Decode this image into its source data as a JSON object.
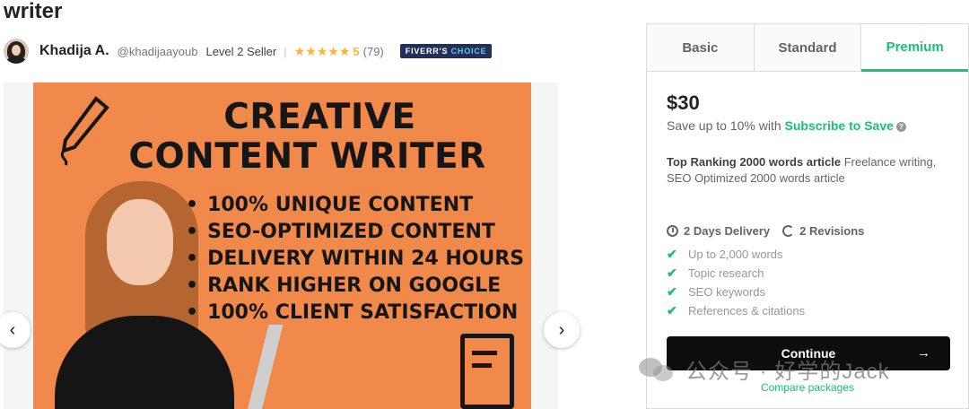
{
  "gig": {
    "title": "writer"
  },
  "seller": {
    "name": "Khadija A.",
    "handle": "@khadijaayoub",
    "level": "Level 2 Seller",
    "separator": "|",
    "stars": "★★★★★",
    "rating": "5",
    "reviews": "(79)",
    "badge_main": "FIVERR'S",
    "badge_accent": "CHOICE"
  },
  "gallery": {
    "headline_1": "CREATIVE",
    "headline_2": "CONTENT WRITER",
    "bullets": [
      "100% UNIQUE CONTENT",
      "SEO-OPTIMIZED CONTENT",
      "DELIVERY WITHIN 24 HOURS",
      "RANK HIGHER ON GOOGLE",
      "100% CLIENT SATISFACTION"
    ],
    "prev_icon": "‹",
    "next_icon": "›"
  },
  "package": {
    "tabs": [
      "Basic",
      "Standard",
      "Premium"
    ],
    "active_tab": "Premium",
    "price": "$30",
    "save_prefix": "Save up to 10% with ",
    "save_link": "Subscribe to Save",
    "desc_bold": "Top Ranking 2000 words article",
    "desc_rest": " Freelance writing, SEO Optimized 2000 words article",
    "delivery": "2 Days Delivery",
    "revisions": "2 Revisions",
    "features": [
      "Up to 2,000 words",
      "Topic research",
      "SEO keywords",
      "References & citations"
    ],
    "continue_label": "Continue",
    "continue_arrow": "→",
    "compare_label": "Compare packages"
  },
  "watermark": {
    "text": "公众号 · 好学的Jack"
  },
  "colors": {
    "accent": "#1dbf73",
    "star": "#ffb33e",
    "badge": "#222f5b",
    "hero": "#f0894a"
  }
}
